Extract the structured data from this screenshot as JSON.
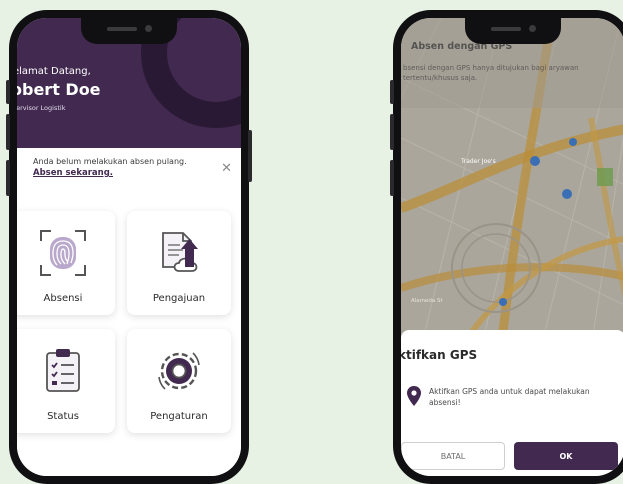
{
  "colors": {
    "background": "#e8f2e4",
    "primary": "#41294f",
    "phone_frame": "#101012"
  },
  "home": {
    "greeting": "elamat Datang,",
    "user_name": "obert Doe",
    "user_role": "pervisor Logistik",
    "notice": {
      "text": "Anda belum melakukan absen pulang.",
      "link": "Absen sekarang.",
      "close_icon": "✕"
    },
    "menu": [
      {
        "label": "Absensi",
        "icon": "fingerprint-icon"
      },
      {
        "label": "Pengajuan",
        "icon": "document-upload-icon"
      },
      {
        "label": "Status",
        "icon": "checklist-icon"
      },
      {
        "label": "Pengaturan",
        "icon": "gear-icon"
      }
    ]
  },
  "gps": {
    "header_title": "Absen dengan GPS",
    "header_desc": "bsensi dengan GPS hanya ditujukan bagi aryawan tertentu/khusus saja.",
    "map_labels": [
      "Trader Joe's",
      "Alameda St"
    ],
    "dialog": {
      "title": "ktifkan GPS",
      "message": "Aktifkan GPS anda untuk dapat melakukan absensi!",
      "cancel_label": "BATAL",
      "ok_label": "OK"
    }
  }
}
